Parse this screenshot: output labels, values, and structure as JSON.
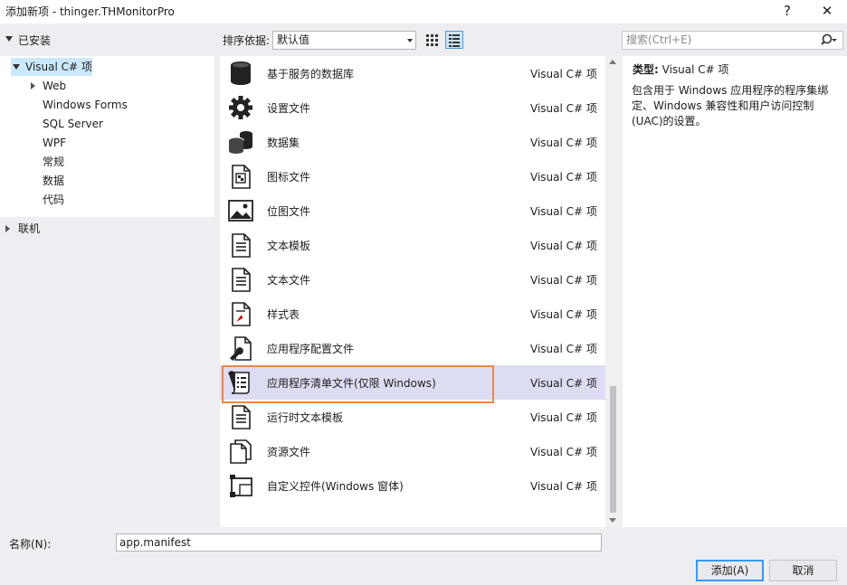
{
  "window": {
    "title": "添加新项 - thinger.THMonitorPro",
    "help": "?",
    "close": "✕"
  },
  "toolbar": {
    "sort_label": "排序依据:",
    "sort_value": "默认值",
    "search_placeholder": "搜索(Ctrl+E)"
  },
  "tree": {
    "installed": "已安装",
    "visual_csharp": "Visual C# 项",
    "children": [
      "Web",
      "Windows Forms",
      "SQL Server",
      "WPF",
      "常规",
      "数据",
      "代码"
    ],
    "online": "联机"
  },
  "items": [
    {
      "name": "基于服务的数据库",
      "type": "Visual C# 项",
      "icon": "database-icon"
    },
    {
      "name": "设置文件",
      "type": "Visual C# 项",
      "icon": "gear-icon"
    },
    {
      "name": "数据集",
      "type": "Visual C# 项",
      "icon": "dataset-icon"
    },
    {
      "name": "图标文件",
      "type": "Visual C# 项",
      "icon": "icon-file-icon"
    },
    {
      "name": "位图文件",
      "type": "Visual C# 项",
      "icon": "image-icon"
    },
    {
      "name": "文本模板",
      "type": "Visual C# 项",
      "icon": "text-template-icon"
    },
    {
      "name": "文本文件",
      "type": "Visual C# 项",
      "icon": "text-file-icon"
    },
    {
      "name": "样式表",
      "type": "Visual C# 项",
      "icon": "stylesheet-icon"
    },
    {
      "name": "应用程序配置文件",
      "type": "Visual C# 项",
      "icon": "config-file-icon"
    },
    {
      "name": "应用程序清单文件(仅限 Windows)",
      "type": "Visual C# 项",
      "icon": "manifest-icon",
      "selected": true
    },
    {
      "name": "运行时文本模板",
      "type": "Visual C# 项",
      "icon": "runtime-template-icon"
    },
    {
      "name": "资源文件",
      "type": "Visual C# 项",
      "icon": "resource-file-icon"
    },
    {
      "name": "自定义控件(Windows 窗体)",
      "type": "Visual C# 项",
      "icon": "custom-control-icon"
    }
  ],
  "details": {
    "type_label": "类型:",
    "type_value": "Visual C# 项",
    "description": "包含用于 Windows 应用程序的程序集绑定、Windows 兼容性和用户访问控制(UAC)的设置。"
  },
  "footer": {
    "name_label": "名称(N):",
    "name_value": "app.manifest",
    "add_label": "添加(A)",
    "cancel_label": "取消"
  }
}
